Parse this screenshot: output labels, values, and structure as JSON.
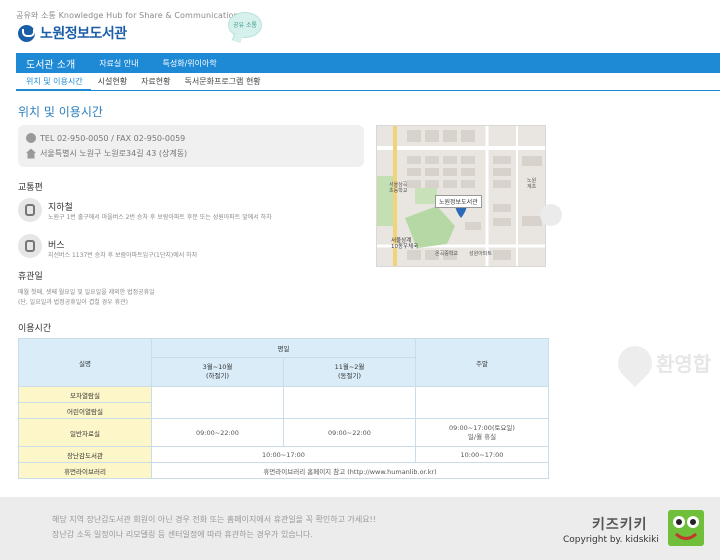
{
  "header": {
    "tagline": "공유와 소통 Knowledge Hub for Share & Communication",
    "logo_text": "노원정보도서관",
    "bubble_text": "공유 소통"
  },
  "nav": {
    "items": [
      "도서관 소개",
      "자료실 안내",
      "특성화/위이아학"
    ]
  },
  "subnav": {
    "items": [
      "위치 및 이용시간",
      "시설현황",
      "자료현황",
      "독서문화프로그램 현황"
    ]
  },
  "page": {
    "title": "위치 및 이용시간"
  },
  "contact": {
    "phone": "TEL 02-950-0050 / FAX 02-950-0059",
    "address": "서울특별시 노원구 노원로34길 43 (상계동)"
  },
  "map": {
    "labels": {
      "library": "노원정보도서관",
      "school1": "서울상곡\n초등학교",
      "station": "서울상계\n10동우체국",
      "school2": "온곡중학교",
      "apt": "성원아파트",
      "top_right": "노원\n계초"
    }
  },
  "transport": {
    "heading": "교통편",
    "subway_title": "지하철",
    "subway_desc": "노원구 1번 출구에서 마을버스 2번 승차 후 보람아파트 후문 또는 성원아파트 앞에서 하차",
    "bus_title": "버스",
    "bus_desc": "지선버스 1137번 승차 후 보람아파트입구(1단지)에서 하차"
  },
  "closed": {
    "heading": "휴관일",
    "line1": "매월 첫째, 셋째 월요일 및 일요일을 제외한 법정공휴일",
    "line2": "(단, 일요일과 법정공휴일이 겹칠 경우 휴관)"
  },
  "hours": {
    "heading": "이용시간",
    "col_room": "실명",
    "col_weekday": "평일",
    "col_summer": "3월~10월\n(하절기)",
    "col_winter": "11월~2월\n(동절기)",
    "col_weekend": "주말",
    "rows": [
      {
        "name": "모자열람실",
        "summer": "",
        "winter": "",
        "weekend": ""
      },
      {
        "name": "어린이열람실",
        "summer": "",
        "winter": "",
        "weekend": ""
      },
      {
        "name": "일반자료실",
        "summer": "09:00~22:00",
        "winter": "09:00~22:00",
        "weekend": "09:00~17:00(토요일)\n일/월 휴실"
      },
      {
        "name": "장난감도서관",
        "merged_weekday": "10:00~17:00",
        "weekend": "10:00~17:00"
      },
      {
        "name": "휴먼라이브러리",
        "merged_all": "휴먼라이브러리 홈페이지 참고 (http://www.humanlib.or.kr)"
      }
    ]
  },
  "watermark": {
    "text": "환영합"
  },
  "footer": {
    "line1": "해당 지역 장난감도서관 회원이 아닌 경우 전화 또는 홈페이지에서 휴관일을 꼭 확인하고 가세요!!",
    "line2": "장난감 소독 일정이나 리모델링 등 센터일정에 따라 휴관하는 경우가 있습니다.",
    "brand": "키즈키키",
    "copyright": "Copyright by. kidskiki"
  },
  "colors": {
    "accent": "#1e8ad6",
    "title": "#2b7fbf",
    "table_header": "#d9ecf8",
    "row_header": "#fdf6c9",
    "footer_bg": "#ececec"
  }
}
